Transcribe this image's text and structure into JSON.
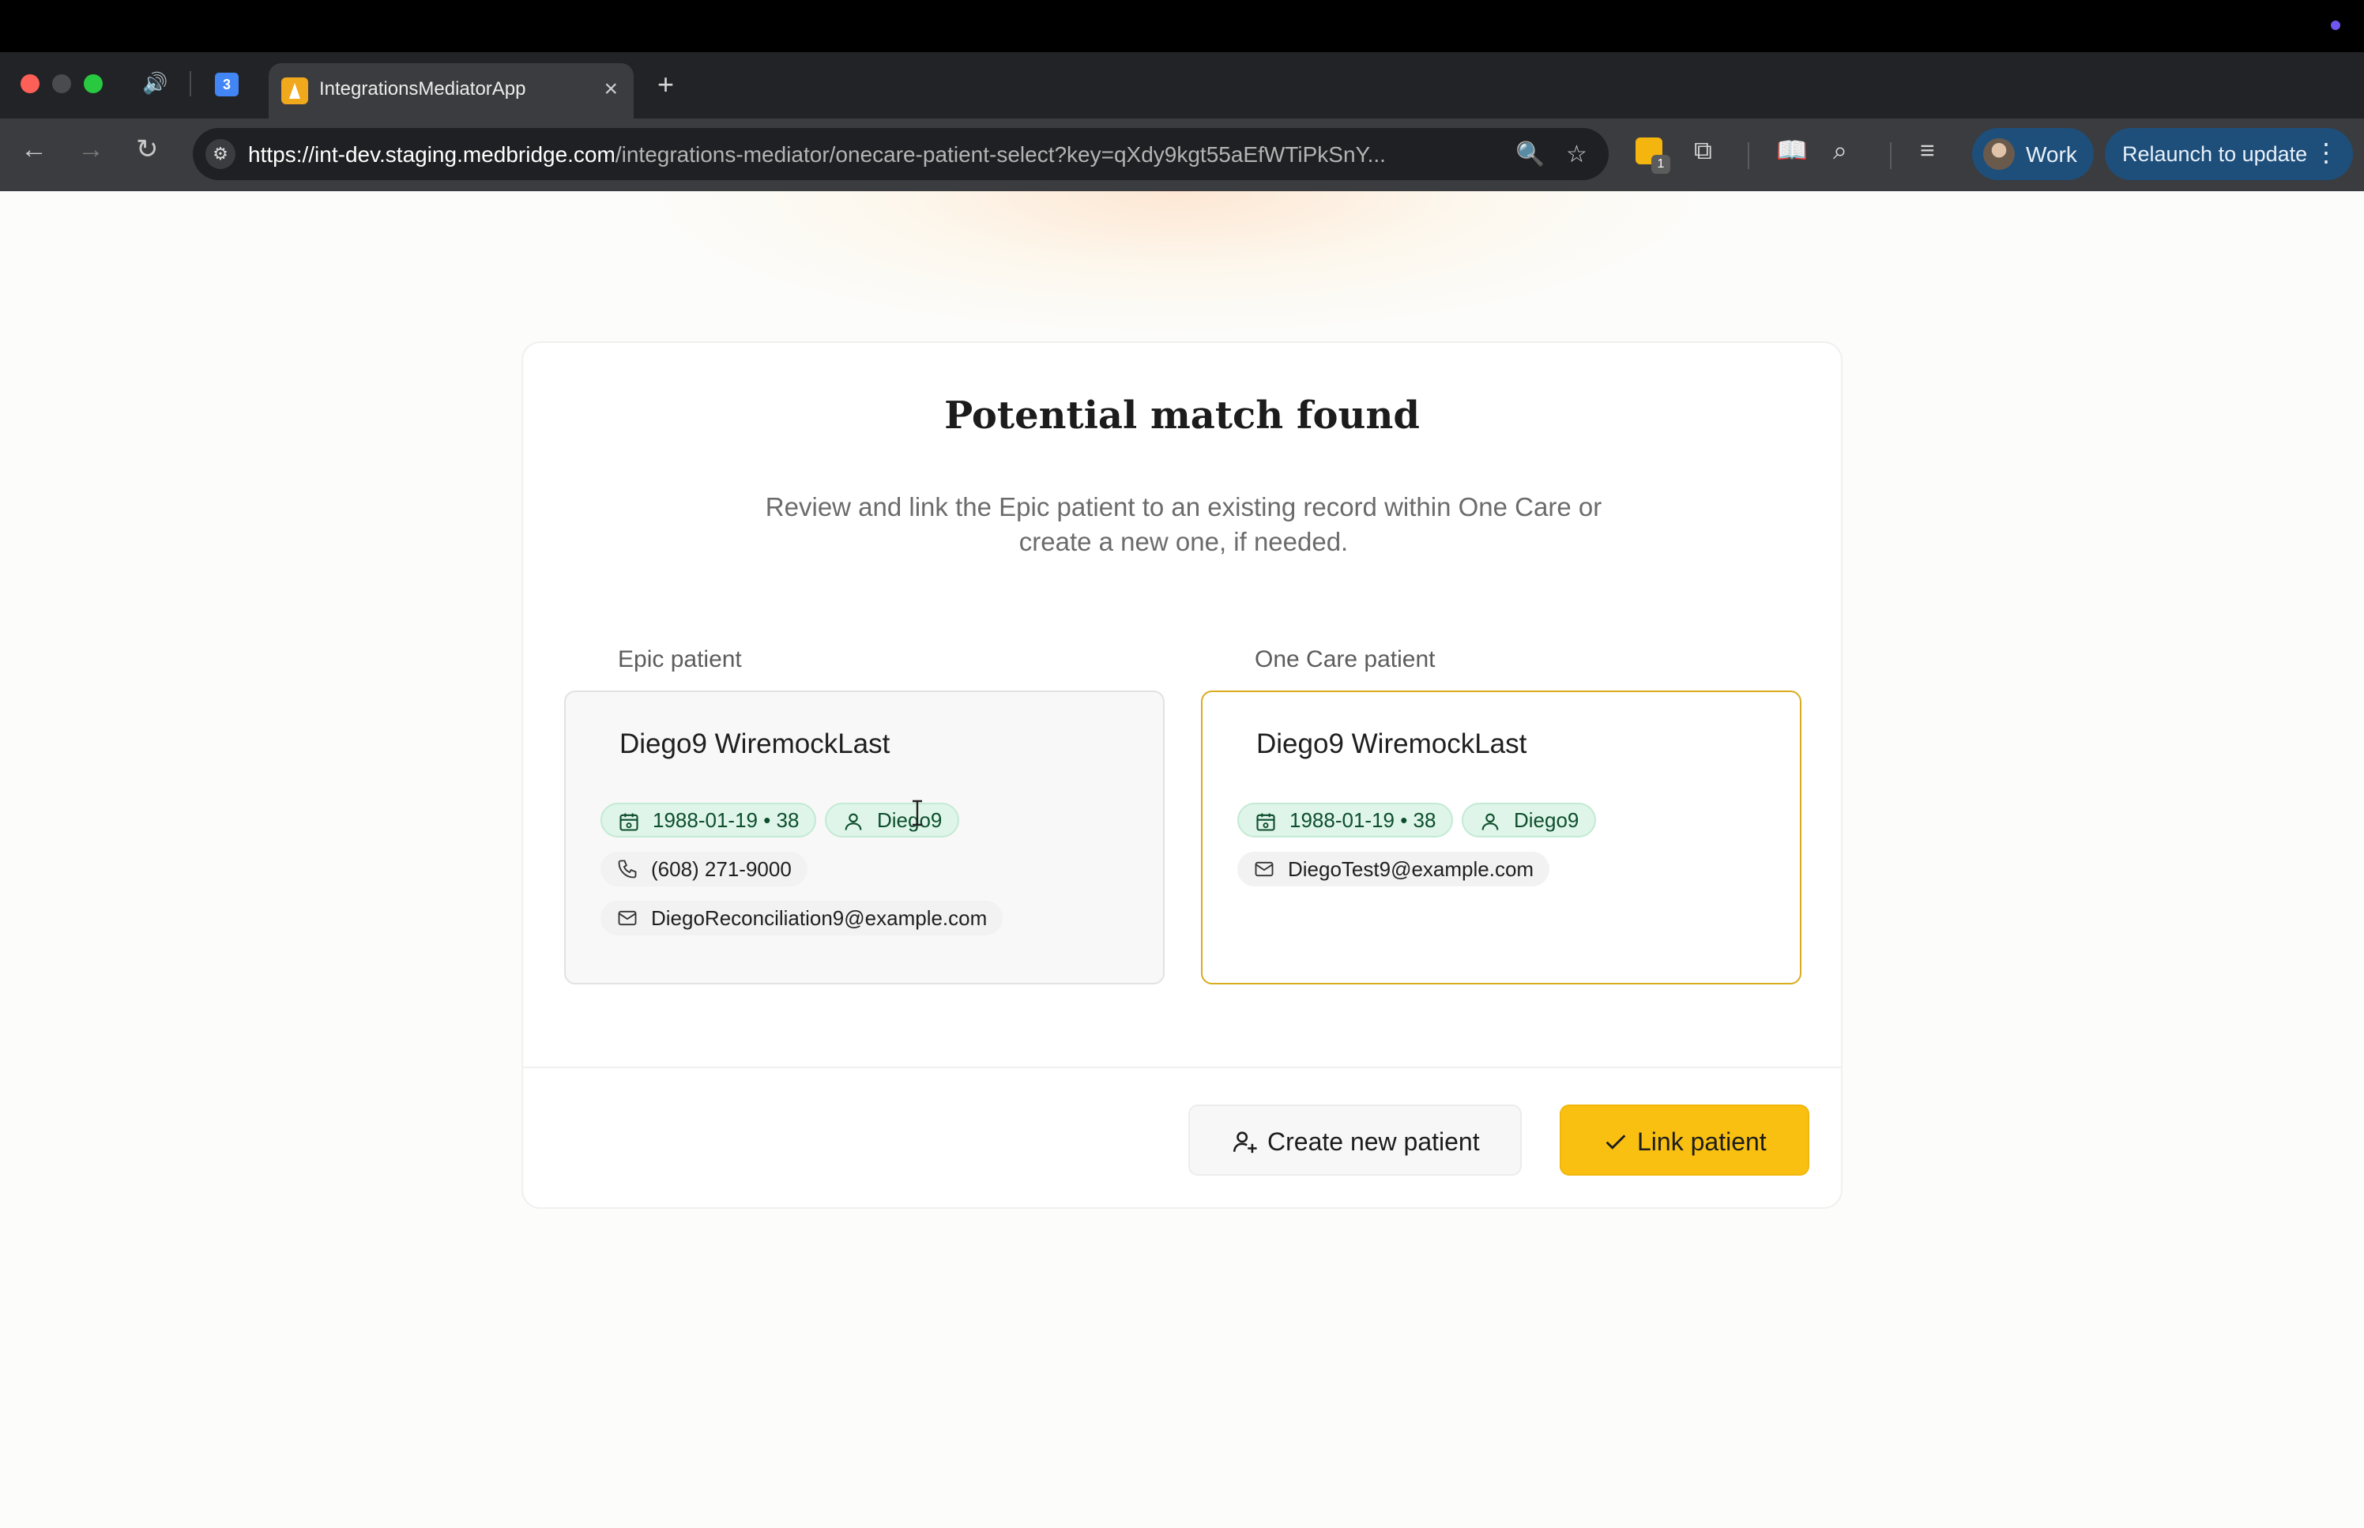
{
  "browser": {
    "tab_title": "IntegrationsMediatorApp",
    "calendar_icon_text": "3",
    "url_host": "https://int-dev.staging.medbridge.com",
    "url_path": "/integrations-mediator/onecare-patient-select?key=qXdy9kgt55aEfWTiPkSnY...",
    "extension_badge": "1",
    "profile_label": "Work",
    "relaunch_label": "Relaunch to update"
  },
  "page": {
    "title": "Potential match found",
    "description": "Review and link the Epic patient to an existing record within One Care or create a new one, if needed.",
    "epic_label": "Epic patient",
    "onecare_label": "One Care patient",
    "epic_patient": {
      "name": "Diego9 WiremockLast",
      "dob_age": "1988-01-19 • 38",
      "first_name": "Diego9",
      "phone": "(608) 271-9000",
      "email": "DiegoReconciliation9@example.com"
    },
    "onecare_patient": {
      "name": "Diego9 WiremockLast",
      "dob_age": "1988-01-19 • 38",
      "first_name": "Diego9",
      "email": "DiegoTest9@example.com"
    },
    "create_button": "Create new patient",
    "link_button": "Link patient"
  },
  "colors": {
    "accent": "#f9c012",
    "match_border": "#d9ab1e",
    "chip_green_bg": "#dff5e9",
    "chip_green_text": "#0c4e2c"
  }
}
